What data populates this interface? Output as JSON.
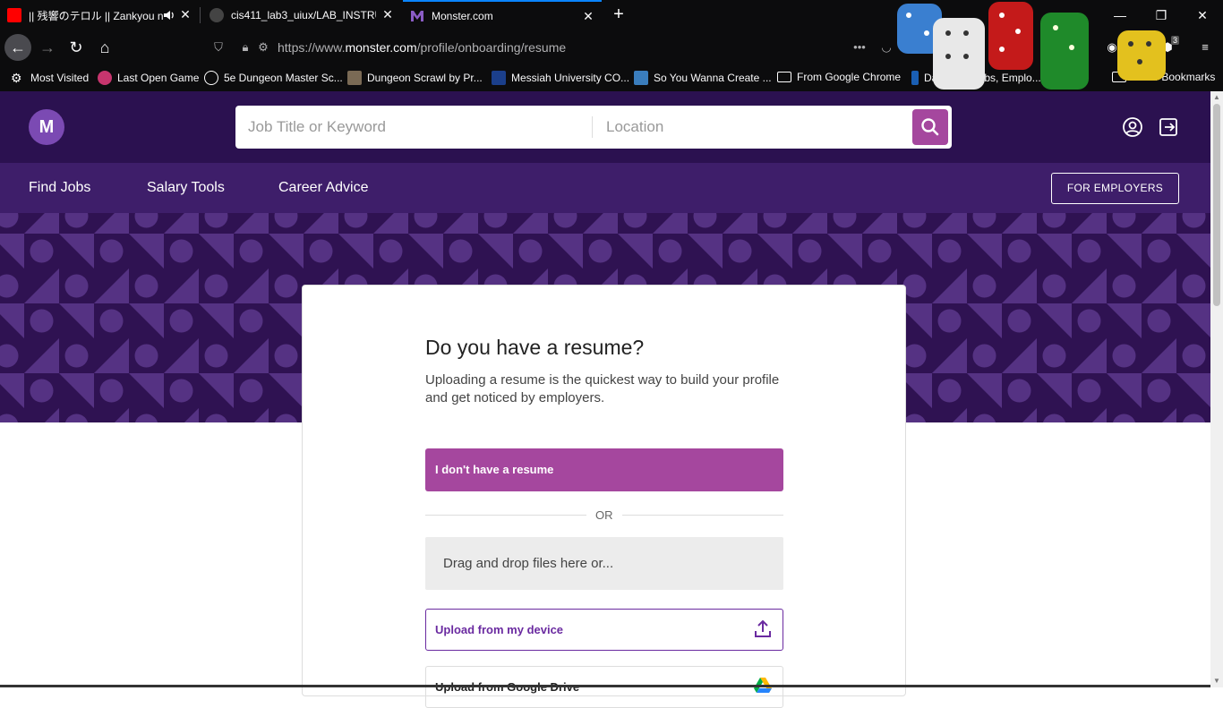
{
  "browser": {
    "tabs": [
      {
        "title": "|| 残響のテロル || Zankyou n",
        "active": false
      },
      {
        "title": "cis411_lab3_uiux/LAB_INSTRUC",
        "active": false
      },
      {
        "title": "Monster.com",
        "active": true
      }
    ],
    "url_prefix": "https://www.",
    "url_domain": "monster.com",
    "url_path": "/profile/onboarding/resume",
    "bookmarks": [
      "Most Visited",
      "Last Open Game",
      "5e Dungeon Master Sc...",
      "Dungeon Scrawl by Pr...",
      "Messiah University CO...",
      "So You Wanna Create ...",
      "From Google Chrome",
      "Database Jobs, Emplo...",
      "Other Bookmarks"
    ],
    "badge_count": "3",
    "accent_color": "#0a84ff"
  },
  "site": {
    "logo_letter": "M",
    "search_keyword_placeholder": "Job Title or Keyword",
    "search_location_placeholder": "Location",
    "nav": [
      "Find Jobs",
      "Salary Tools",
      "Career Advice"
    ],
    "employers_button": "FOR EMPLOYERS",
    "brand_purple": "#a5479e",
    "header_color": "#2b1150"
  },
  "card": {
    "title": "Do you have a resume?",
    "subtitle": "Uploading a resume is the quickest way to build your profile and get noticed by employers.",
    "no_resume_button": "I don't have a resume",
    "or_text": "OR",
    "dropzone_text": "Drag and drop files here or...",
    "upload_device_button": "Upload from my device",
    "upload_gdrive_button": "Upload from Google Drive"
  }
}
